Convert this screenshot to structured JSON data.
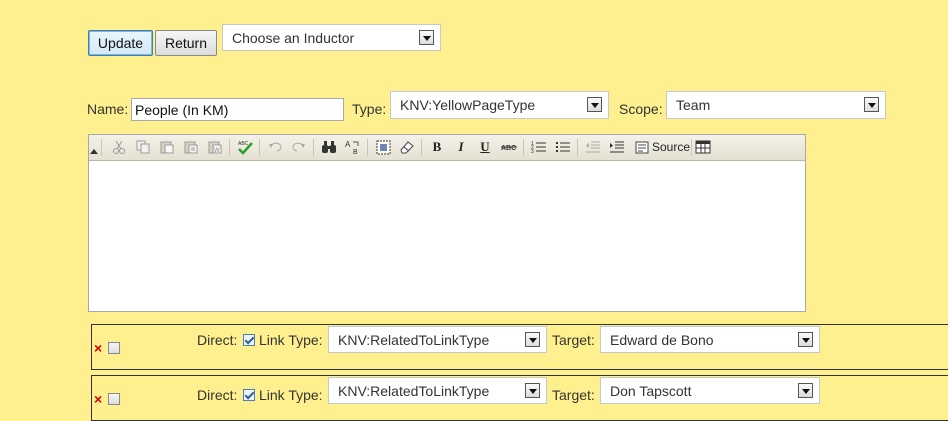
{
  "buttons": {
    "update": "Update",
    "return": "Return"
  },
  "inductor": {
    "selected": "Choose an Inductor"
  },
  "form": {
    "name_label": "Name:",
    "name_value": "People (In KM)",
    "type_label": "Type:",
    "type_value": "KNV:YellowPageType",
    "scope_label": "Scope:",
    "scope_value": "Team"
  },
  "editor": {
    "source_label": "Source"
  },
  "links": [
    {
      "direct_label": "Direct:",
      "link_type_label": "Link Type:",
      "link_type_value": "KNV:RelatedToLinkType",
      "target_label": "Target:",
      "target_value": "Edward de Bono",
      "delete_symbol": "×",
      "direct_checked": true
    },
    {
      "direct_label": "Direct:",
      "link_type_label": "Link Type:",
      "link_type_value": "KNV:RelatedToLinkType",
      "target_label": "Target:",
      "target_value": "Don Tapscott",
      "delete_symbol": "×",
      "direct_checked": true
    }
  ],
  "colors": {
    "background": "#fff08f",
    "delete_red": "#d40000"
  }
}
